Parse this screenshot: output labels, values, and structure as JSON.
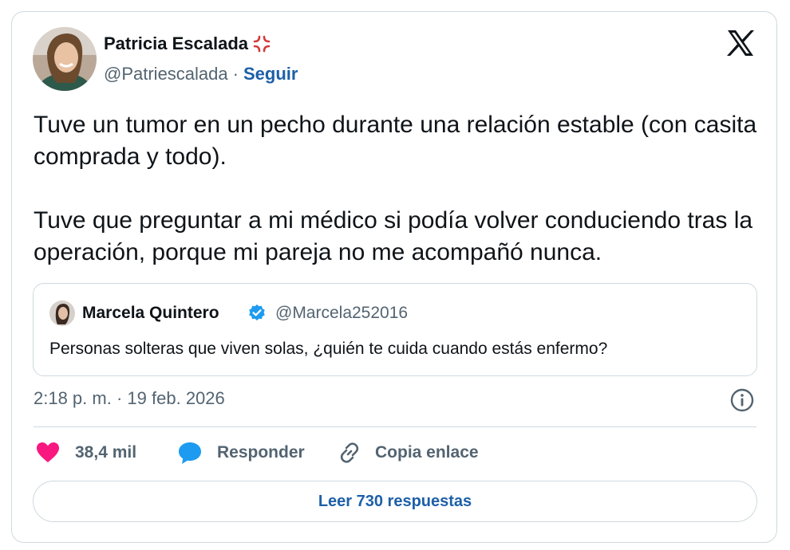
{
  "author": {
    "name": "Patricia Escalada",
    "emoji": "💢",
    "handle": "@Patriescalada",
    "separator": "·",
    "follow_label": "Seguir"
  },
  "tweet": {
    "paragraphs": [
      "Tuve un tumor en un pecho durante una relación estable (con casita comprada y todo).",
      "Tuve que preguntar a mi médico si podía volver conduciendo tras la operación, porque mi pareja no me acompañó nunca."
    ],
    "time": "2:18 p. m.",
    "date_separator": "·",
    "date": "19 feb. 2026"
  },
  "quoted": {
    "name": "Marcela Quintero",
    "handle": "@Marcela252016",
    "text": "Personas solteras que viven solas, ¿quién te cuida cuando estás enfermo?"
  },
  "actions": {
    "likes": "38,4 mil",
    "reply_label": "Responder",
    "copy_label": "Copia enlace"
  },
  "read_replies_label": "Leer 730 respuestas",
  "colors": {
    "accent": "#1d5fa8",
    "heart": "#f91880",
    "reply_bubble": "#1d9bf0",
    "secondary_text": "#536471",
    "border": "#cfd9de"
  },
  "icons": [
    "x-logo-icon",
    "verified-badge-icon",
    "heart-icon",
    "reply-bubble-icon",
    "link-icon",
    "info-icon"
  ]
}
